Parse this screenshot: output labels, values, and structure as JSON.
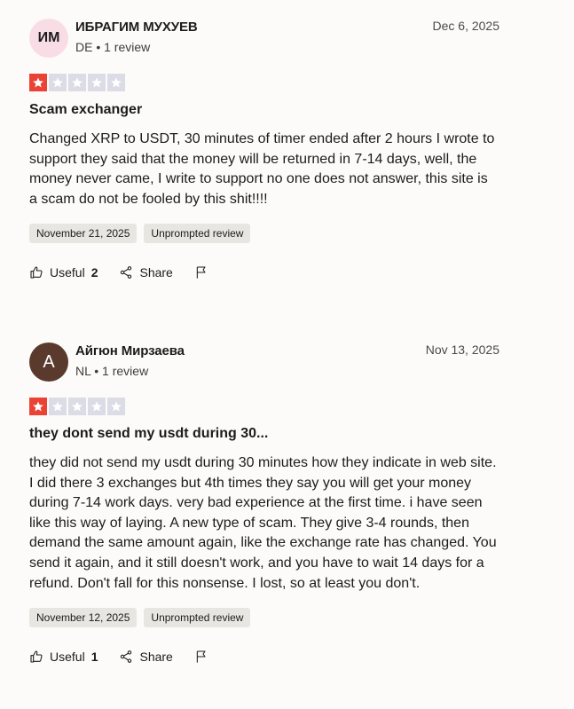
{
  "reviews": [
    {
      "avatar_initials": "ИМ",
      "name": "ИБРАГИМ МУХУЕВ",
      "meta": "DE • 1 review",
      "date": "Dec 6, 2025",
      "rating": 1,
      "title": "Scam exchanger",
      "body": "Changed XRP to USDT, 30 minutes of timer ended after 2 hours I wrote to support they said that the money will be returned in 7-14 days, well, the money never came, I write to support no one does not answer, this site is a scam do not be fooled by this shit!!!!",
      "experience_date": "November 21, 2025",
      "tag": "Unprompted review",
      "useful_label": "Useful",
      "useful_count": "2",
      "share_label": "Share"
    },
    {
      "avatar_initials": "A",
      "name": "Айгюн Мирзаева",
      "meta": "NL • 1 review",
      "date": "Nov 13, 2025",
      "rating": 1,
      "title": "they dont send my usdt during 30...",
      "body": "they did not send my usdt during 30 minutes how they indicate in web site. I did there 3 exchanges but 4th times they say you will get your money during 7-14 work days. very bad experience at the first time. i have seen like this way of laying. A new type of scam. They give 3-4 rounds, then demand the same amount again, like the exchange rate has changed. You send it again, and it still doesn't work, and you have to wait 14 days for a refund. Don't fall for this nonsense. I lost, so at least you don't.",
      "experience_date": "November 12, 2025",
      "tag": "Unprompted review",
      "useful_label": "Useful",
      "useful_count": "1",
      "share_label": "Share"
    }
  ],
  "colors": {
    "star_filled": "#ea4335",
    "star_empty": "#dcdce6",
    "background": "#fcfbf9",
    "tag_bg": "#e8e6e1"
  },
  "icons": [
    "star-icon",
    "thumbs-up-icon",
    "share-icon",
    "flag-icon"
  ]
}
